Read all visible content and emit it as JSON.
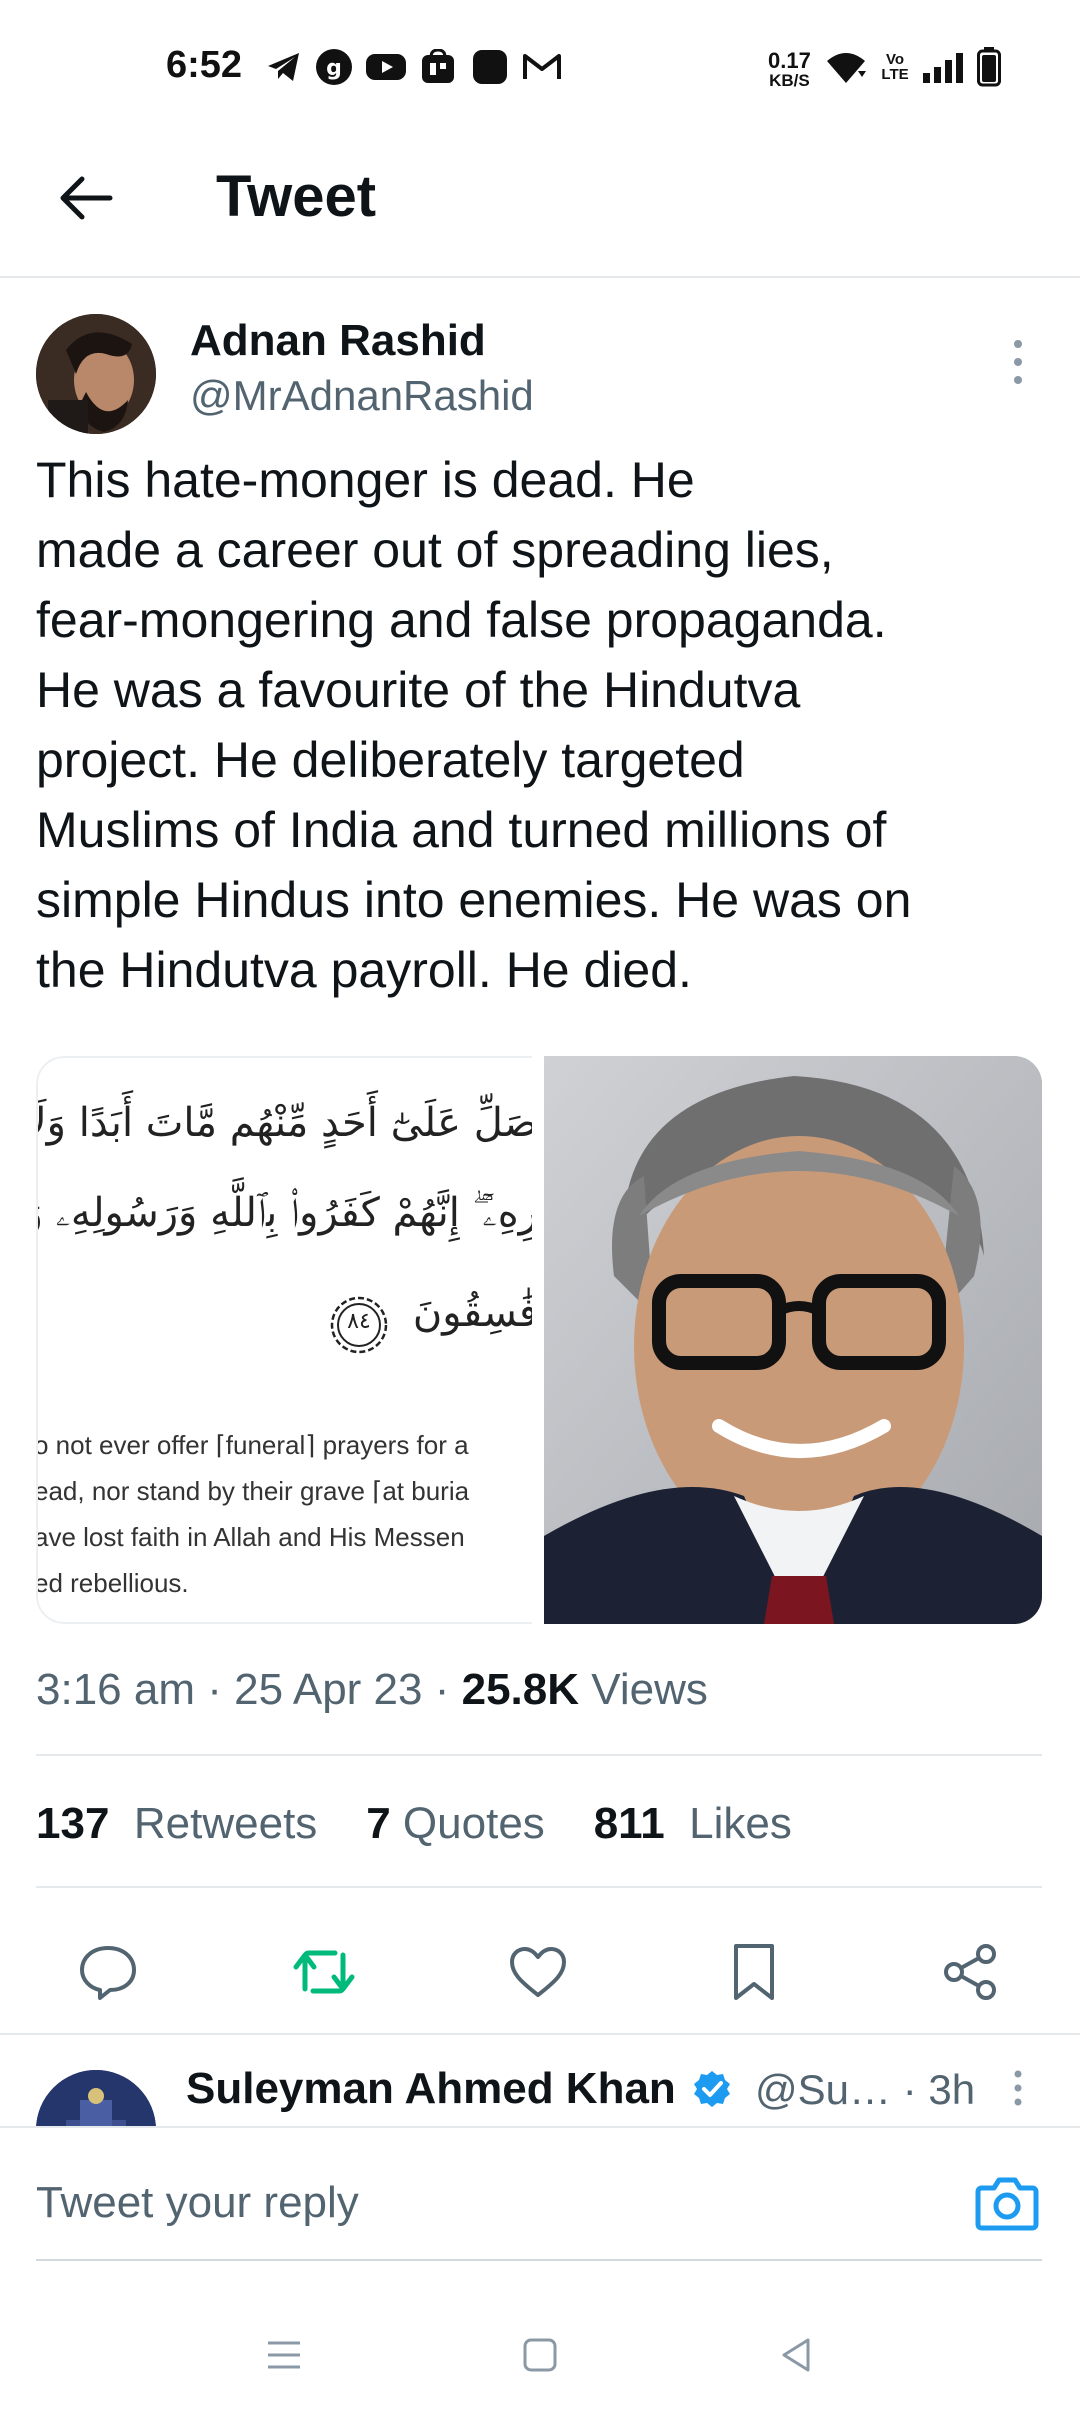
{
  "status_bar": {
    "time": "6:52",
    "net_speed_value": "0.17",
    "net_speed_unit": "KB/S",
    "volte_top": "Vo",
    "volte_bottom": "LTE"
  },
  "header": {
    "title": "Tweet"
  },
  "tweet": {
    "display_name": "Adnan Rashid",
    "handle": "@MrAdnanRashid",
    "text": "This hate-monger is dead. He\nmade a career out of spreading lies,\nfear-mongering and false propaganda.\nHe was a favourite of the Hindutva\nproject. He deliberately targeted\nMuslims of India and turned millions of\nsimple Hindus into enemies. He was on\nthe Hindutva payroll. He died.",
    "media": {
      "arabic_line_1": "صَلِّ عَلَىٰٓ أَحَدٍ مِّنْهُم مَّاتَ أَبَدًا وَلَا تَ",
      "arabic_line_2": "رِهِۦٓ ۖ إِنَّهُمْ كَفَرُوا۟ بِٱللَّهِ وَرَسُولِهِۦ وَمَا",
      "arabic_line_3": "فَٰسِقُونَ",
      "verse_number": "٨٤",
      "translation_1": "o not ever offer ⌈funeral⌉ prayers for a",
      "translation_2": "ead, nor stand by their grave ⌈at buria",
      "translation_3": "ave lost faith in Allah and His Messen",
      "translation_4": "ed rebellious."
    },
    "time": "3:16 am",
    "date": "25 Apr 23",
    "views_count": "25.8K",
    "views_label": "Views",
    "retweets_count": "137",
    "retweets_label": "Retweets",
    "quotes_count": "7",
    "quotes_label": "Quotes",
    "likes_count": "811",
    "likes_label": "Likes"
  },
  "reply_preview": {
    "display_name": "Suleyman Ahmed Khan",
    "handle": "@Su…",
    "time": "· 3h"
  },
  "reply_box": {
    "placeholder": "Tweet your reply"
  },
  "colors": {
    "accent": "#1d9bf0",
    "retweet_green": "#00ba7c",
    "secondary_text": "#536471"
  }
}
